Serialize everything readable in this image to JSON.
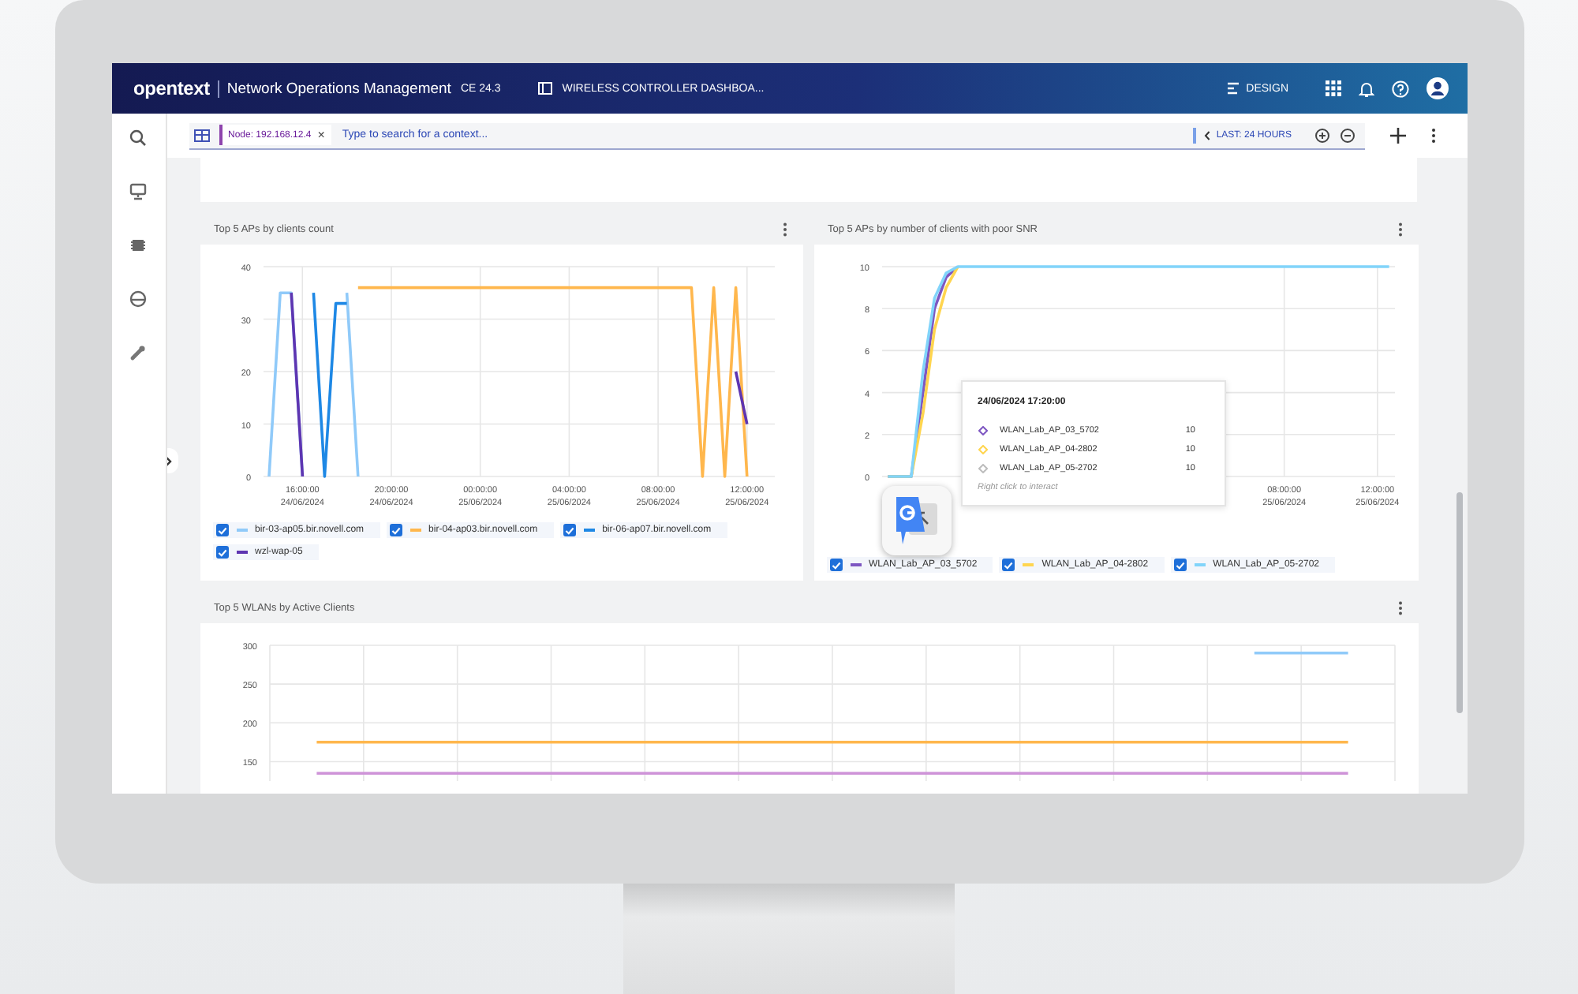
{
  "header": {
    "logo": "opentext",
    "product": "Network Operations Management",
    "version": "CE 24.3",
    "dashboard": "WIRELESS CONTROLLER DASHBOA...",
    "design": "DESIGN"
  },
  "filter_bar": {
    "tag": "Node: 192.168.12.4",
    "tag_close": "×",
    "placeholder": "Type to search for a context...",
    "time_range": "LAST: 24 HOURS"
  },
  "cards": [
    {
      "title": "Top 5 APs by clients count",
      "legend": [
        {
          "checked": true
        },
        {
          "checked": true
        },
        {
          "checked": true
        },
        {
          "checked": true
        }
      ],
      "chart_data": {
        "type": "line",
        "categories": [
          null,
          null,
          null,
          "16:00:00 24/06/2024",
          null,
          null,
          null,
          null,
          null,
          null,
          null,
          "20:00:00 24/06/2024",
          null,
          null,
          null,
          null,
          null,
          null,
          null,
          "00:00:00 25/06/2024",
          null,
          null,
          null,
          null,
          null,
          null,
          null,
          "04:00:00 25/06/2024",
          null,
          null,
          null,
          null,
          null,
          null,
          null,
          "08:00:00 25/06/2024",
          null,
          null,
          null,
          null,
          null,
          null,
          null,
          "12:00:00 25/06/2024",
          null,
          null
        ],
        "ylim": [
          0,
          40
        ],
        "yticks": [
          0,
          10,
          20,
          30,
          40
        ],
        "grid": true,
        "series": [
          {
            "name": "bir-03-ap05.bir.novell.com",
            "color": "#90caf9",
            "values": [
              0,
              35,
              35,
              0,
              null,
              null,
              null,
              35,
              0,
              null,
              null,
              null,
              null,
              null,
              null,
              null,
              null,
              null,
              null,
              null,
              null,
              null,
              null,
              null,
              null,
              null,
              null,
              null,
              null,
              null,
              null,
              null,
              null,
              null,
              null,
              null,
              null,
              null,
              null,
              null,
              null,
              null,
              null,
              null,
              null,
              null
            ]
          },
          {
            "name": "bir-04-ap03.bir.novell.com",
            "color": "#ffb74d",
            "values": [
              null,
              null,
              null,
              null,
              null,
              null,
              null,
              null,
              36,
              36,
              36,
              36,
              36,
              36,
              36,
              36,
              36,
              36,
              36,
              36,
              36,
              36,
              36,
              36,
              36,
              36,
              36,
              36,
              36,
              36,
              36,
              36,
              36,
              36,
              36,
              36,
              36,
              36,
              36,
              0,
              36,
              0,
              36,
              0,
              null,
              null
            ]
          },
          {
            "name": "bir-06-ap07.bir.novell.com",
            "color": "#1e88e5",
            "values": [
              null,
              null,
              null,
              null,
              35,
              0,
              33,
              33,
              null,
              null,
              null,
              null,
              null,
              null,
              null,
              null,
              null,
              null,
              null,
              null,
              null,
              null,
              null,
              null,
              null,
              null,
              null,
              null,
              null,
              null,
              null,
              null,
              null,
              null,
              null,
              null,
              null,
              null,
              null,
              null,
              null,
              null,
              null,
              null,
              null,
              null
            ]
          },
          {
            "name": "wzl-wap-05",
            "color": "#5e35b1",
            "values": [
              null,
              null,
              35,
              0,
              null,
              null,
              null,
              null,
              null,
              null,
              null,
              null,
              null,
              null,
              null,
              null,
              null,
              null,
              null,
              null,
              null,
              null,
              null,
              null,
              null,
              null,
              null,
              null,
              null,
              null,
              null,
              null,
              null,
              null,
              null,
              null,
              null,
              null,
              null,
              null,
              null,
              null,
              20,
              10,
              null,
              null
            ]
          }
        ]
      }
    },
    {
      "title": "Top 5 APs by number of clients with poor SNR",
      "legend": [
        {
          "checked": true
        },
        {
          "checked": true
        },
        {
          "checked": true
        }
      ],
      "chart_data": {
        "type": "line",
        "categories": [
          null,
          null,
          null,
          null,
          null,
          null,
          null,
          null,
          null,
          null,
          null,
          null,
          null,
          null,
          null,
          null,
          null,
          null,
          null,
          null,
          null,
          null,
          null,
          null,
          null,
          null,
          null,
          null,
          null,
          null,
          null,
          null,
          null,
          null,
          "08:00:00 25/06/2024",
          null,
          null,
          null,
          null,
          null,
          null,
          null,
          "12:00:00 25/06/2024",
          null
        ],
        "ylim": [
          0,
          10
        ],
        "yticks": [
          0,
          2,
          4,
          6,
          8,
          10
        ],
        "grid": true,
        "series": [
          {
            "name": "WLAN_Lab_AP_03_5702",
            "color": "#7e57c2",
            "values": [
              0,
              0,
              0,
              4,
              8,
              9.5,
              10,
              null,
              null,
              null,
              null,
              null,
              null,
              null,
              null,
              null,
              null,
              null,
              null,
              null,
              null,
              null,
              null,
              null,
              null,
              null,
              null,
              null,
              null,
              null,
              null,
              null,
              null,
              null,
              null,
              null,
              null,
              null,
              null,
              null,
              null,
              null,
              null,
              null
            ]
          },
          {
            "name": "WLAN_Lab_AP_04-2802",
            "color": "#ffd54f",
            "values": [
              0,
              0,
              0,
              3,
              7,
              9,
              10,
              null,
              null,
              null,
              null,
              null,
              null,
              null,
              null,
              null,
              null,
              null,
              null,
              null,
              null,
              null,
              null,
              null,
              null,
              null,
              null,
              null,
              null,
              null,
              null,
              null,
              null,
              null,
              null,
              null,
              null,
              null,
              null,
              null,
              null,
              null,
              null,
              null
            ]
          },
          {
            "name": "WLAN_Lab_AP_05-2702",
            "color": "#81d4fa",
            "values": [
              0,
              0,
              0,
              5,
              8.5,
              9.7,
              10,
              10,
              10,
              10,
              10,
              10,
              10,
              10,
              10,
              10,
              10,
              10,
              10,
              10,
              10,
              10,
              10,
              10,
              10,
              10,
              10,
              10,
              10,
              10,
              10,
              10,
              10,
              10,
              10,
              10,
              10,
              10,
              10,
              10,
              10,
              10,
              10,
              10
            ]
          }
        ]
      },
      "tooltip": {
        "title": "24/06/2024 17:20:00",
        "rows": [
          {
            "label": "WLAN_Lab_AP_03_5702",
            "value": "10",
            "color": "#7e57c2"
          },
          {
            "label": "WLAN_Lab_AP_04-2802",
            "value": "10",
            "color": "#ffd54f"
          },
          {
            "label": "WLAN_Lab_AP_05-2702",
            "value": "10",
            "color": "#bdbdbd"
          }
        ],
        "hint": "Right click to interact"
      }
    },
    {
      "title": "Top 5 WLANs by Active Clients",
      "chart_data": {
        "type": "line",
        "categories": [
          null,
          null,
          null,
          null,
          null,
          null,
          null,
          null,
          null,
          null,
          null,
          null
        ],
        "ylim": [
          125,
          300
        ],
        "yticks": [
          150,
          200,
          250,
          300
        ],
        "grid": true,
        "series": [
          {
            "color": "#90caf9",
            "values": [
              null,
              null,
              null,
              null,
              null,
              null,
              null,
              null,
              null,
              null,
              290,
              290
            ]
          },
          {
            "color": "#ffb74d",
            "values": [
              175,
              175,
              175,
              175,
              175,
              175,
              175,
              175,
              175,
              175,
              175,
              175
            ]
          },
          {
            "color": "#ce93d8",
            "values": [
              135,
              135,
              135,
              135,
              135,
              135,
              135,
              135,
              135,
              135,
              135,
              135
            ]
          }
        ]
      }
    }
  ]
}
